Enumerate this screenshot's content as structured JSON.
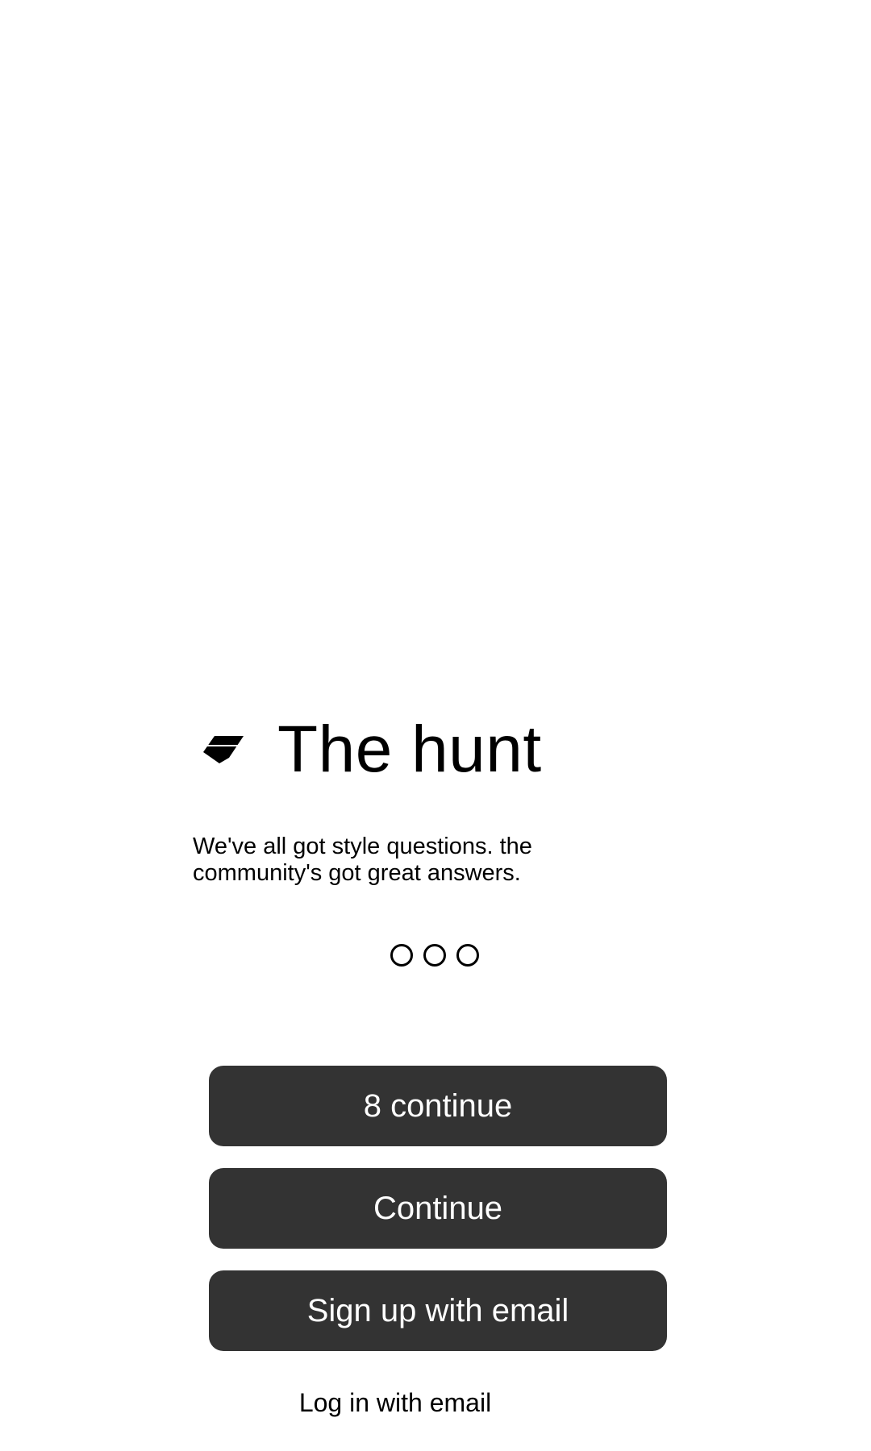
{
  "app": {
    "title": "The hunt",
    "logo_icon": "tag-icon",
    "tagline_line1": "We've all got style questions. the",
    "tagline_line2": "community's got great answers."
  },
  "pager": {
    "page_count": 3,
    "active_index": null
  },
  "actions": {
    "primary_label": "8 continue",
    "secondary_label": "Continue",
    "signup_label": "Sign up with email",
    "login_label": "Log in with email"
  },
  "colors": {
    "button_background": "#333333",
    "button_text": "#ffffff",
    "page_background": "#ffffff",
    "text": "#000000"
  }
}
